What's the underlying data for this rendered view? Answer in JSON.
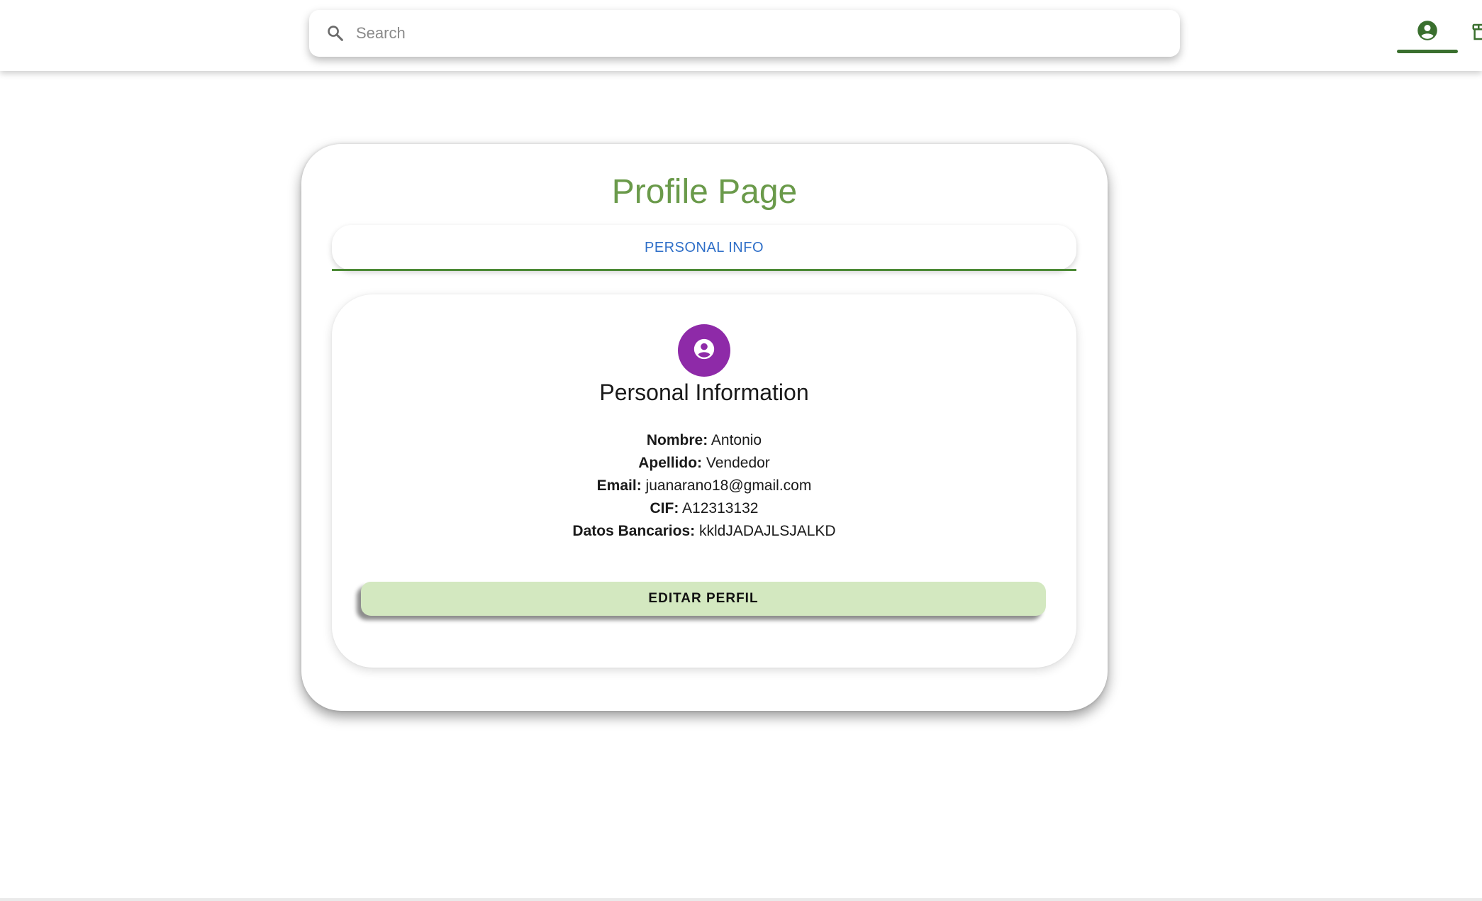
{
  "header": {
    "search": {
      "placeholder": "Search",
      "value": ""
    },
    "nav": [
      {
        "icon": "account-circle-icon",
        "active": true
      },
      {
        "icon": "storefront-icon",
        "active": false
      }
    ],
    "accent_color": "#3a6f2e"
  },
  "profile": {
    "page_title": "Profile Page",
    "tabs": [
      {
        "label": "PERSONAL INFO",
        "active": true
      }
    ],
    "section_heading": "Personal Information",
    "avatar": {
      "icon": "account-circle-icon",
      "color": "#8e2aa8"
    },
    "fields": [
      {
        "label": "Nombre:",
        "value": "Antonio"
      },
      {
        "label": "Apellido:",
        "value": "Vendedor"
      },
      {
        "label": "Email:",
        "value": "juanarano18@gmail.com"
      },
      {
        "label": "CIF:",
        "value": "A12313132"
      },
      {
        "label": "Datos Bancarios:",
        "value": "kkldJADAJLSJALKD"
      }
    ],
    "edit_button_label": "EDITAR PERFIL"
  },
  "colors": {
    "title": "#6a9a4a",
    "tab_text": "#2f6fc8",
    "button_bg": "#d3e8c0"
  }
}
